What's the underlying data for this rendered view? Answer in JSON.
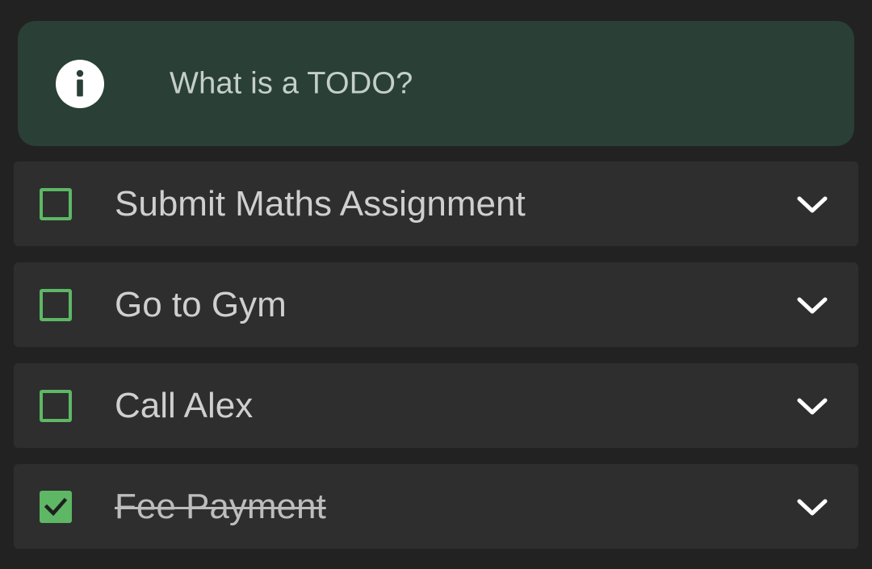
{
  "info_banner": {
    "text": "What is a TODO?",
    "icon": "info-icon"
  },
  "colors": {
    "background": "#222222",
    "banner_bg": "#2a3f36",
    "item_bg": "#2e2e2e",
    "accent_green": "#5db765"
  },
  "todos": [
    {
      "title": "Submit Maths Assignment",
      "checked": false,
      "expand_icon": "chevron-down-icon"
    },
    {
      "title": "Go to Gym",
      "checked": false,
      "expand_icon": "chevron-down-icon"
    },
    {
      "title": "Call Alex",
      "checked": false,
      "expand_icon": "chevron-down-icon"
    },
    {
      "title": "Fee Payment",
      "checked": true,
      "expand_icon": "chevron-down-icon"
    }
  ]
}
